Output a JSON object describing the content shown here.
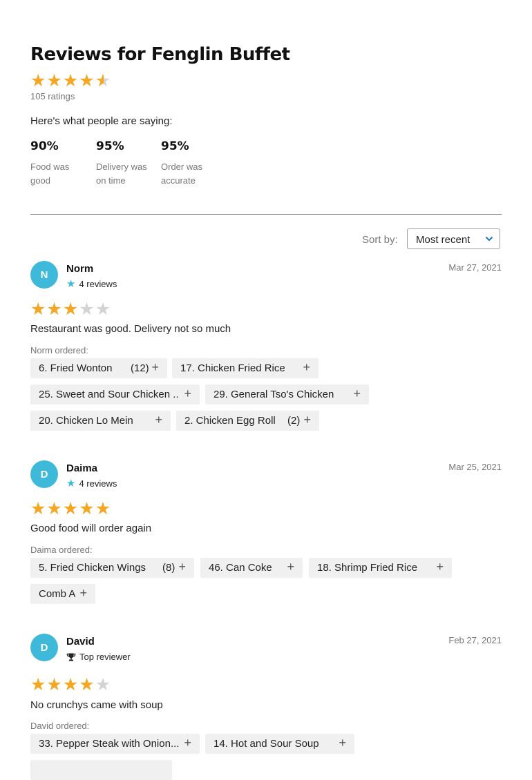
{
  "header": {
    "title": "Reviews for Fenglin Buffet",
    "overall_rating": 4.5,
    "ratings_count": "105 ratings",
    "saying": "Here's what people are saying:"
  },
  "stats": [
    {
      "pct": "90%",
      "desc": "Food was good"
    },
    {
      "pct": "95%",
      "desc": "Delivery was on time"
    },
    {
      "pct": "95%",
      "desc": "Order was accurate"
    }
  ],
  "sort": {
    "label": "Sort by:",
    "value": "Most recent"
  },
  "reviews": [
    {
      "initial": "N",
      "name": "Norm",
      "meta_icon": "star-icon",
      "meta": "4 reviews",
      "date": "Mar 27, 2021",
      "rating": 3,
      "text": "Restaurant was good. Delivery not so much",
      "ordered_label": "Norm ordered:",
      "items": [
        {
          "name": "6. Fried Wonton",
          "qty": "(12)"
        },
        {
          "name": "17. Chicken Fried Rice",
          "qty": ""
        },
        {
          "name": "25. Sweet and Sour Chicken ...",
          "qty": ""
        },
        {
          "name": "29. General Tso's Chicken",
          "qty": ""
        },
        {
          "name": "20. Chicken Lo Mein",
          "qty": ""
        },
        {
          "name": "2. Chicken Egg Roll",
          "qty": "(2)"
        }
      ]
    },
    {
      "initial": "D",
      "name": "Daima",
      "meta_icon": "star-icon",
      "meta": "4 reviews",
      "date": "Mar 25, 2021",
      "rating": 5,
      "text": "Good food will order again",
      "ordered_label": "Daima ordered:",
      "items": [
        {
          "name": "5. Fried Chicken Wings",
          "qty": "(8)"
        },
        {
          "name": "46. Can Coke",
          "qty": ""
        },
        {
          "name": "18. Shrimp Fried Rice",
          "qty": ""
        },
        {
          "name": "Comb A",
          "qty": ""
        }
      ]
    },
    {
      "initial": "D",
      "name": "David",
      "meta_icon": "trophy-icon",
      "meta": "Top reviewer",
      "date": "Feb 27, 2021",
      "rating": 4,
      "text": "No crunchys came with soup",
      "ordered_label": "David ordered:",
      "items": [
        {
          "name": "33. Pepper Steak with Onion...",
          "qty": ""
        },
        {
          "name": "14. Hot and Sour Soup",
          "qty": ""
        },
        {
          "name": "",
          "qty": ""
        }
      ]
    }
  ],
  "colors": {
    "star": "#f5a623",
    "star_off": "#d3d3d3",
    "avatar": "#3fb9d9",
    "chip": "#f0f0f0",
    "chevron": "#1a73c8"
  }
}
